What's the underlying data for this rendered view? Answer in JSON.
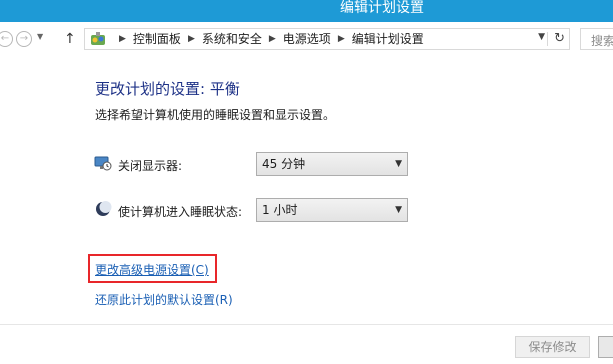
{
  "window": {
    "title": "编辑计划设置"
  },
  "nav": {
    "breadcrumbs": [
      "控制面板",
      "系统和安全",
      "电源选项",
      "编辑计划设置"
    ],
    "search_placeholder": "搜索"
  },
  "main": {
    "heading": "更改计划的设置: 平衡",
    "subtext": "选择希望计算机使用的睡眠设置和显示设置。",
    "settings": [
      {
        "label": "关闭显示器:",
        "value": "45 分钟",
        "icon": "monitor-clock-icon"
      },
      {
        "label": "使计算机进入睡眠状态:",
        "value": "1 小时",
        "icon": "moon-sleep-icon"
      }
    ],
    "links": {
      "advanced": "更改高级电源设置(C)",
      "restore": "还原此计划的默认设置(R)"
    }
  },
  "footer": {
    "save_label": "保存修改"
  },
  "colors": {
    "titlebar": "#1e9ad6",
    "heading": "#1e3287",
    "link": "#1a5fb4",
    "highlight": "#e8262a"
  }
}
